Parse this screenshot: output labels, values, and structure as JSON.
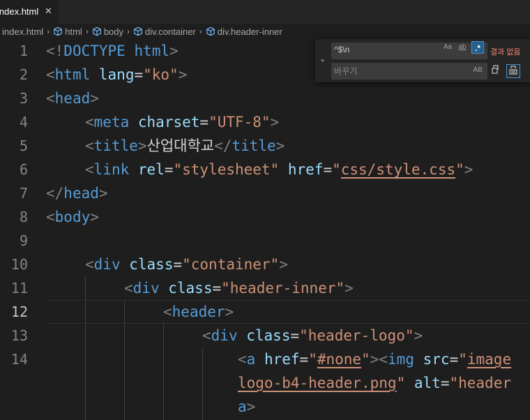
{
  "tab": {
    "label": "index.html",
    "close": "✕"
  },
  "breadcrumb": {
    "items": [
      "index.html",
      "html",
      "body",
      "div.container",
      "div.header-inner"
    ],
    "separator": "›"
  },
  "editor": {
    "line_numbers": [
      "1",
      "2",
      "3",
      "4",
      "5",
      "6",
      "7",
      "8",
      "9",
      "10",
      "11",
      "12",
      "13",
      "14"
    ],
    "active_line": "12",
    "lines": {
      "l1": [
        "<!",
        "DOCTYPE",
        " ",
        "html",
        ">"
      ],
      "l2": [
        "<",
        "html",
        " ",
        "lang",
        "=",
        "\"ko\"",
        ">"
      ],
      "l3": [
        "<",
        "head",
        ">"
      ],
      "l4": [
        "<",
        "meta",
        " ",
        "charset",
        "=",
        "\"UTF-8\"",
        ">"
      ],
      "l5": [
        "<",
        "title",
        ">",
        "산업대학교",
        "</",
        "title",
        ">"
      ],
      "l6": [
        "<",
        "link",
        " ",
        "rel",
        "=",
        "\"stylesheet\"",
        " ",
        "href",
        "=",
        "\"",
        "css/style.css",
        "\"",
        ">"
      ],
      "l7": [
        "</",
        "head",
        ">"
      ],
      "l8": [
        "<",
        "body",
        ">"
      ],
      "l10": [
        "<",
        "div",
        " ",
        "class",
        "=",
        "\"container\"",
        ">"
      ],
      "l11": [
        "<",
        "div",
        " ",
        "class",
        "=",
        "\"header-inner\"",
        ">"
      ],
      "l12": [
        "<",
        "header",
        ">"
      ],
      "l13": [
        "<",
        "div",
        " ",
        "class",
        "=",
        "\"header-logo\"",
        ">"
      ],
      "l14a": [
        "<",
        "a",
        " ",
        "href",
        "=",
        "\"",
        "#none",
        "\"",
        "><",
        "img",
        " ",
        "src",
        "=",
        "\"",
        "image"
      ],
      "l14b": [
        "logo-b4-header.png",
        "\"",
        " ",
        "alt",
        "=",
        "\"header"
      ],
      "l14c": [
        "a",
        ">"
      ]
    }
  },
  "find_widget": {
    "toggle": "⌄",
    "find_value": "^$\\n",
    "replace_placeholder": "바꾸기",
    "match_case": "Aa",
    "whole_word": "ab",
    "regex": ".*",
    "result": "결과 없음",
    "preserve_case": "AB"
  }
}
